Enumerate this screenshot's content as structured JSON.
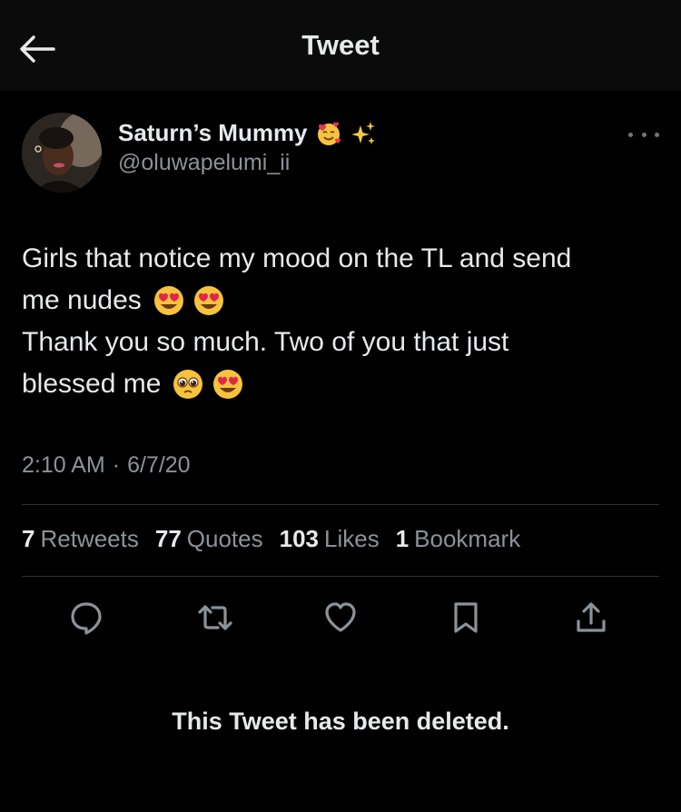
{
  "header": {
    "title": "Tweet",
    "back_icon": "arrow-left-icon"
  },
  "author": {
    "name": "Saturn’s Mummy",
    "name_emojis": [
      "smiling-face-with-hearts",
      "sparkles"
    ],
    "handle": "@oluwapelumi_ii"
  },
  "tweet": {
    "lines": [
      "Girls that notice my mood on the TL and send",
      "me nudes",
      "Thank you so much. Two of you that just",
      "blessed me"
    ],
    "line2_emojis": [
      "heart-eyes",
      "heart-eyes"
    ],
    "line4_emojis": [
      "pleading-face",
      "heart-eyes"
    ],
    "time": "2:10 AM",
    "separator": "·",
    "date": "6/7/20"
  },
  "stats": {
    "retweets": {
      "count": "7",
      "label": "Retweets"
    },
    "quotes": {
      "count": "77",
      "label": "Quotes"
    },
    "likes": {
      "count": "103",
      "label": "Likes"
    },
    "bookmarks": {
      "count": "1",
      "label": "Bookmark"
    }
  },
  "actions": [
    "reply-icon",
    "retweet-icon",
    "like-icon",
    "bookmark-icon",
    "share-icon"
  ],
  "deleted_notice": "This Tweet has been deleted.",
  "colors": {
    "background": "#000000",
    "header": "#0b0b0b",
    "text": "#e7e9ea",
    "muted": "#8b9298",
    "divider": "#2f3336"
  }
}
